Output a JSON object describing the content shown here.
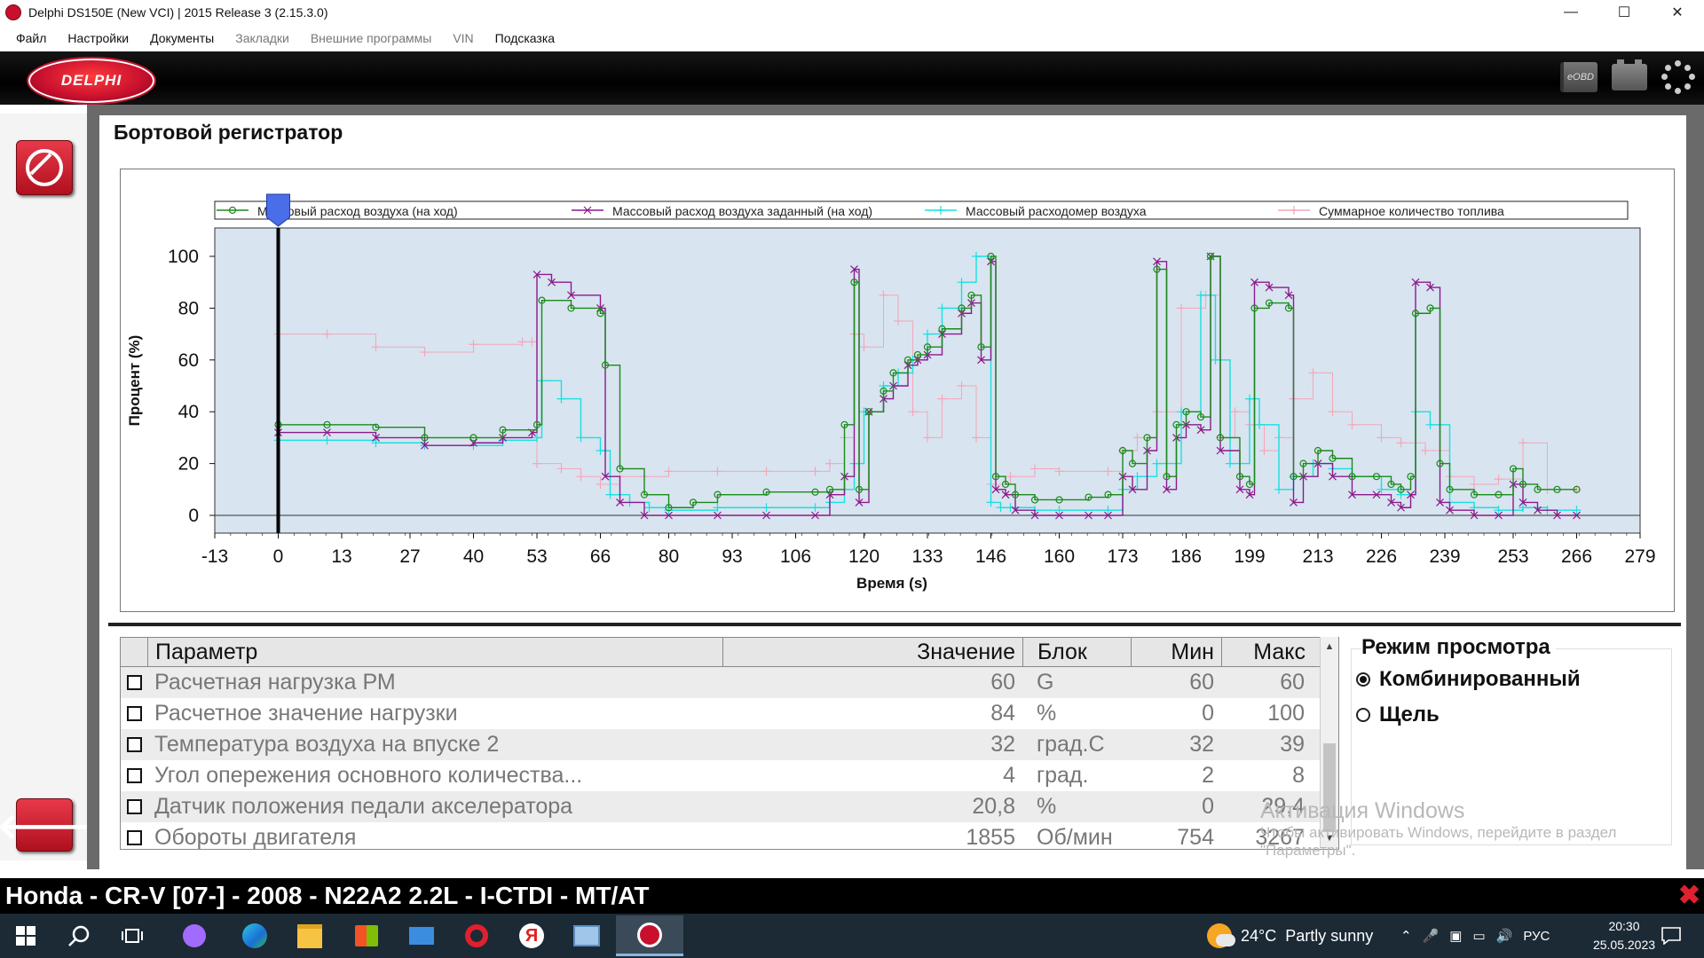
{
  "window": {
    "title": "Delphi DS150E (New VCI) | 2015 Release 3 (2.15.3.0)",
    "min": "—",
    "max": "☐",
    "close": "✕"
  },
  "menu": [
    {
      "label": "Файл",
      "enabled": true
    },
    {
      "label": "Настройки",
      "enabled": true
    },
    {
      "label": "Документы",
      "enabled": true
    },
    {
      "label": "Закладки",
      "enabled": false
    },
    {
      "label": "Внешние программы",
      "enabled": false
    },
    {
      "label": "VIN",
      "enabled": false
    },
    {
      "label": "Подсказка",
      "enabled": true
    }
  ],
  "toolbar": {
    "logo": "DELPHI",
    "eobd_label": "eOBD",
    "icons": [
      "eobd-icon",
      "battery-icon",
      "loading-spinner-icon"
    ]
  },
  "page": {
    "title": "Бортовой регистратор"
  },
  "colors": {
    "series1": "#1a8a1a",
    "series2": "#8b1a8b",
    "series3": "#18e0e0",
    "series4": "#f4a7b9",
    "plot_bg": "#d8e4f0",
    "accent_red": "#c8102e"
  },
  "chart_data": {
    "type": "line",
    "xlabel": "Время (s)",
    "ylabel": "Процент (%)",
    "xlim": [
      -13,
      279
    ],
    "ylim": [
      0,
      100
    ],
    "xticks": [
      -13,
      0,
      13,
      27,
      40,
      53,
      66,
      80,
      93,
      106,
      120,
      133,
      146,
      160,
      173,
      186,
      199,
      213,
      226,
      239,
      253,
      266,
      279
    ],
    "yticks": [
      0,
      20,
      40,
      60,
      80,
      100
    ],
    "cursor_x": 0,
    "legend_position": "top",
    "grid": false,
    "series": [
      {
        "name": "Массовый расход воздуха (на ход)",
        "color": "#1a8a1a",
        "x": [
          0,
          10,
          20,
          30,
          40,
          46,
          53,
          54,
          60,
          66,
          67,
          70,
          75,
          80,
          85,
          90,
          100,
          110,
          113,
          116,
          118,
          119,
          121,
          124,
          126,
          129,
          131,
          133,
          136,
          140,
          142,
          144,
          146,
          147,
          149,
          151,
          155,
          160,
          166,
          170,
          173,
          175,
          178,
          180,
          182,
          184,
          186,
          189,
          191,
          193,
          197,
          199,
          200,
          203,
          207,
          208,
          210,
          213,
          216,
          220,
          225,
          228,
          230,
          232,
          233,
          236,
          238,
          240,
          245,
          250,
          253,
          255,
          258,
          262,
          266
        ],
        "y": [
          35,
          35,
          34,
          30,
          30,
          33,
          35,
          83,
          80,
          78,
          58,
          18,
          8,
          3,
          5,
          8,
          9,
          9,
          10,
          35,
          90,
          10,
          40,
          48,
          55,
          60,
          62,
          65,
          72,
          80,
          85,
          65,
          100,
          15,
          12,
          8,
          6,
          6,
          7,
          8,
          25,
          20,
          30,
          95,
          15,
          35,
          40,
          38,
          100,
          30,
          15,
          12,
          80,
          82,
          80,
          15,
          20,
          25,
          22,
          15,
          15,
          12,
          10,
          15,
          78,
          80,
          20,
          10,
          8,
          8,
          18,
          12,
          10,
          10,
          10
        ]
      },
      {
        "name": "Массовый расход воздуха заданный (на ход)",
        "color": "#8b1a8b",
        "x": [
          0,
          10,
          20,
          30,
          40,
          46,
          52,
          53,
          56,
          60,
          66,
          67,
          70,
          75,
          80,
          90,
          100,
          110,
          113,
          116,
          118,
          119,
          121,
          124,
          126,
          129,
          131,
          133,
          136,
          140,
          142,
          144,
          146,
          147,
          149,
          151,
          155,
          160,
          166,
          170,
          173,
          175,
          178,
          180,
          182,
          184,
          186,
          189,
          191,
          193,
          197,
          199,
          200,
          203,
          207,
          208,
          210,
          213,
          216,
          220,
          225,
          228,
          230,
          232,
          233,
          236,
          238,
          240,
          245,
          250,
          253,
          255,
          258,
          262,
          266
        ],
        "y": [
          32,
          32,
          30,
          27,
          28,
          30,
          32,
          93,
          90,
          85,
          80,
          15,
          5,
          0,
          0,
          0,
          0,
          0,
          8,
          15,
          95,
          5,
          40,
          45,
          50,
          58,
          60,
          62,
          70,
          78,
          82,
          60,
          98,
          10,
          8,
          2,
          0,
          0,
          0,
          0,
          15,
          10,
          25,
          98,
          10,
          30,
          35,
          33,
          100,
          25,
          10,
          8,
          90,
          88,
          85,
          5,
          15,
          20,
          15,
          8,
          8,
          5,
          3,
          8,
          90,
          88,
          5,
          2,
          0,
          0,
          12,
          5,
          2,
          0,
          0
        ]
      },
      {
        "name": "Массовый расходомер воздуха",
        "color": "#18e0e0",
        "x": [
          0,
          10,
          20,
          30,
          40,
          46,
          53,
          54,
          58,
          62,
          66,
          68,
          72,
          76,
          80,
          90,
          100,
          110,
          113,
          116,
          118,
          120,
          124,
          127,
          130,
          133,
          136,
          140,
          143,
          146,
          148,
          150,
          155,
          160,
          170,
          173,
          176,
          180,
          185,
          189,
          192,
          195,
          199,
          201,
          205,
          208,
          212,
          216,
          220,
          226,
          230,
          233,
          236,
          240,
          245,
          250,
          255,
          260,
          266
        ],
        "y": [
          29,
          29,
          28,
          27,
          27,
          29,
          30,
          52,
          45,
          30,
          25,
          8,
          5,
          3,
          2,
          3,
          3,
          3,
          5,
          10,
          20,
          40,
          50,
          55,
          60,
          70,
          80,
          90,
          100,
          5,
          3,
          3,
          2,
          2,
          2,
          10,
          15,
          20,
          40,
          85,
          60,
          20,
          45,
          35,
          10,
          15,
          20,
          18,
          15,
          10,
          8,
          40,
          35,
          5,
          3,
          2,
          3,
          2,
          2
        ]
      },
      {
        "name": "Суммарное количество топлива",
        "color": "#f4a7b9",
        "x": [
          0,
          10,
          20,
          30,
          40,
          50,
          52,
          53,
          58,
          62,
          66,
          70,
          75,
          80,
          90,
          100,
          110,
          113,
          116,
          118,
          120,
          124,
          127,
          130,
          133,
          136,
          140,
          143,
          146,
          150,
          155,
          160,
          170,
          173,
          176,
          180,
          185,
          190,
          193,
          196,
          199,
          202,
          205,
          208,
          212,
          216,
          220,
          226,
          230,
          235,
          240,
          245,
          250,
          255,
          260,
          266
        ],
        "y": [
          70,
          70,
          65,
          63,
          66,
          67,
          67,
          20,
          18,
          15,
          12,
          15,
          15,
          17,
          17,
          17,
          17,
          20,
          30,
          70,
          65,
          85,
          75,
          40,
          30,
          45,
          50,
          30,
          12,
          15,
          18,
          17,
          17,
          25,
          30,
          40,
          80,
          85,
          30,
          40,
          35,
          25,
          30,
          45,
          55,
          40,
          35,
          30,
          28,
          25,
          15,
          12,
          14,
          28,
          10,
          10
        ]
      }
    ]
  },
  "params_table": {
    "headers": {
      "param": "Параметр",
      "value": "Значение",
      "unit": "Блок",
      "min": "Мин",
      "max": "Макс"
    },
    "rows": [
      {
        "param": "Расчетная нагрузка РМ",
        "value": "60",
        "unit": "G",
        "min": "60",
        "max": "60"
      },
      {
        "param": "Расчетное значение нагрузки",
        "value": "84",
        "unit": "%",
        "min": "0",
        "max": "100"
      },
      {
        "param": "Температура воздуха на впуске 2",
        "value": "32",
        "unit": "град.С",
        "min": "32",
        "max": "39"
      },
      {
        "param": "Угол опережения основного количества...",
        "value": "4",
        "unit": "град.",
        "min": "2",
        "max": "8"
      },
      {
        "param": "Датчик положения педали акселератора",
        "value": "20,8",
        "unit": "%",
        "min": "0",
        "max": "29,4"
      },
      {
        "param": "Обороты двигателя",
        "value": "1855",
        "unit": "Об/мин",
        "min": "754",
        "max": "3267"
      }
    ]
  },
  "view_mode": {
    "title": "Режим просмотра",
    "options": [
      {
        "label": "Комбинированный",
        "selected": true
      },
      {
        "label": "Щель",
        "selected": false
      }
    ]
  },
  "watermark": {
    "line1": "Активация Windows",
    "line2": "Чтобы активировать Windows, перейдите в раздел",
    "line3": "\"Параметры\"."
  },
  "vehicle": "Honda - CR-V [07-] - 2008 - N22A2 2.2L - I-CTDI - MT/AT",
  "taskbar": {
    "weather_temp": "24°C",
    "weather_text": "Partly sunny",
    "lang": "РУС",
    "time": "20:30",
    "date": "25.05.2023"
  }
}
